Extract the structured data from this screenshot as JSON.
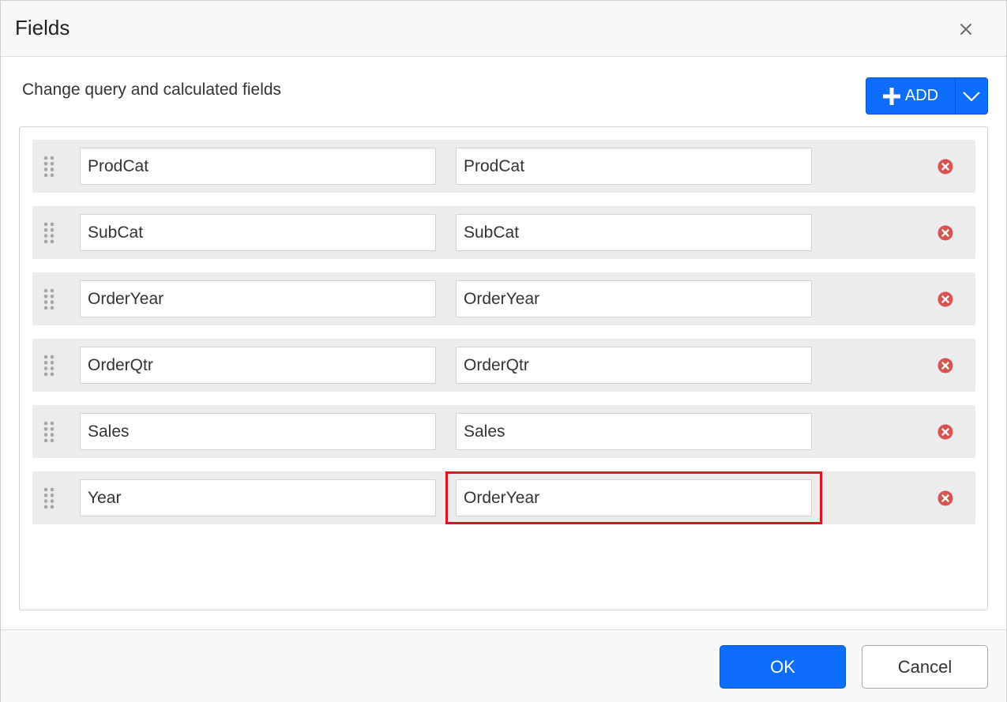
{
  "dialog": {
    "title": "Fields",
    "subheading": "Change query and calculated fields"
  },
  "toolbar": {
    "add_label": "ADD"
  },
  "fields": [
    {
      "name": "ProdCat",
      "value": "ProdCat"
    },
    {
      "name": "SubCat",
      "value": "SubCat"
    },
    {
      "name": "OrderYear",
      "value": "OrderYear"
    },
    {
      "name": "OrderQtr",
      "value": "OrderQtr"
    },
    {
      "name": "Sales",
      "value": "Sales"
    },
    {
      "name": "Year",
      "value": "OrderYear"
    }
  ],
  "footer": {
    "ok_label": "OK",
    "cancel_label": "Cancel"
  },
  "colors": {
    "primary": "#0d6efd",
    "remove": "#d9534f",
    "highlight": "#e8101e"
  }
}
